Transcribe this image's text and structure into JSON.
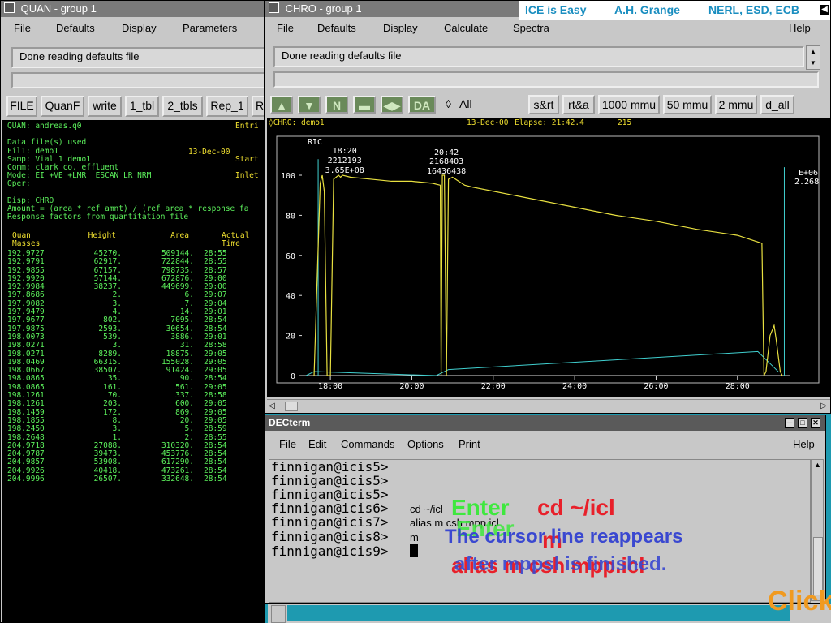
{
  "quan": {
    "title": "QUAN - group 1",
    "menu": [
      "File",
      "Defaults",
      "Display",
      "Parameters"
    ],
    "message": "Done reading defaults file",
    "toolbar": [
      "FILE",
      "QuanF",
      "write",
      "1_tbl",
      "2_tbls",
      "Rep_1",
      "R"
    ],
    "header_lines": [
      "QUAN: andreas.q0",
      "",
      "Data file(s) used",
      "Fil1: demo1",
      "Samp: Vial 1 demo1",
      "Comm: clark co. effluent",
      "Mode: EI +VE +LMR  ESCAN LR NRM",
      "Oper:",
      "",
      "Disp: CHRO",
      "Amount = (area * ref amnt) / (ref area * response fa",
      "Response factors from quantitation file"
    ],
    "header_right": [
      "Entri",
      "Start",
      "Inlet"
    ],
    "file_date": "13-Dec-00",
    "columns": [
      "Quan\nMasses",
      "Height",
      "Area",
      "Actual\nTime"
    ],
    "rows": [
      [
        "192.9727",
        "45270.",
        "509144.",
        "28:55"
      ],
      [
        "192.9791",
        "62917.",
        "722844.",
        "28:55"
      ],
      [
        "192.9855",
        "67157.",
        "798735.",
        "28:57"
      ],
      [
        "192.9920",
        "57144.",
        "672876.",
        "29:00"
      ],
      [
        "192.9984",
        "38237.",
        "449699.",
        "29:00"
      ],
      [
        "197.8686",
        "2.",
        "6.",
        "29:07"
      ],
      [
        "197.9082",
        "3.",
        "7.",
        "29:04"
      ],
      [
        "197.9479",
        "4.",
        "14.",
        "29:01"
      ],
      [
        "197.9677",
        "802.",
        "7095.",
        "28:54"
      ],
      [
        "197.9875",
        "2593.",
        "30654.",
        "28:54"
      ],
      [
        "198.0073",
        "539.",
        "3886.",
        "29:01"
      ],
      [
        "198.0271",
        "3.",
        "31.",
        "28:58"
      ],
      [
        "198.0271",
        "8289.",
        "18875.",
        "29:05"
      ],
      [
        "198.0469",
        "66315.",
        "155028.",
        "29:05"
      ],
      [
        "198.0667",
        "38507.",
        "91424.",
        "29:05"
      ],
      [
        "198.0865",
        "35.",
        "90.",
        "28:54"
      ],
      [
        "198.0865",
        "161.",
        "561.",
        "29:05"
      ],
      [
        "198.1261",
        "70.",
        "337.",
        "28:58"
      ],
      [
        "198.1261",
        "203.",
        "600.",
        "29:05"
      ],
      [
        "198.1459",
        "172.",
        "869.",
        "29:05"
      ],
      [
        "198.1855",
        "8.",
        "20.",
        "29:05"
      ],
      [
        "198.2450",
        "3.",
        "5.",
        "28:59"
      ],
      [
        "198.2648",
        "1.",
        "2.",
        "28:55"
      ],
      [
        "204.9718",
        "27088.",
        "310320.",
        "28:54"
      ],
      [
        "204.9787",
        "39473.",
        "453776.",
        "28:54"
      ],
      [
        "204.9857",
        "53908.",
        "617290.",
        "28:54"
      ],
      [
        "204.9926",
        "40418.",
        "473261.",
        "28:54"
      ],
      [
        "204.9996",
        "26507.",
        "332648.",
        "28:54"
      ]
    ]
  },
  "chro": {
    "title": "CHRO - group 1",
    "banner": [
      "ICE is Easy",
      "A.H. Grange",
      "NERL, ESD, ECB"
    ],
    "menu": [
      "File",
      "Defaults",
      "Display",
      "Calculate",
      "Spectra",
      "Help"
    ],
    "message": "Done reading defaults file",
    "all_label": "All",
    "da_label": "DA",
    "buttons": [
      "s&rt",
      "rt&a",
      "1000 mmu",
      "50 mmu",
      "2 mmu",
      "d_all"
    ],
    "plot_header": "CHRO: demo1",
    "plot_date": "13-Dec-00",
    "plot_elapse": "Elapse: 21:42.4",
    "plot_scan": "215",
    "ric_label": "RIC",
    "peak1": [
      "18:20",
      "2212193",
      "3.65E+08"
    ],
    "peak2": [
      "20:42",
      "2168403",
      "16436438"
    ],
    "scale_right": [
      "E+06",
      "2.268"
    ]
  },
  "chart_data": {
    "type": "line",
    "xlabel": "",
    "ylabel": "",
    "x_ticks": [
      "18:00",
      "20:00",
      "22:00",
      "24:00",
      "26:00",
      "28:00"
    ],
    "y_ticks": [
      "0",
      "20",
      "40",
      "60",
      "80",
      "100"
    ],
    "ylim": [
      0,
      100
    ],
    "series": [
      {
        "color": "#e8e040",
        "x": [
          17.6,
          17.75,
          17.8,
          17.85,
          17.92,
          18.0,
          18.08,
          18.2,
          18.25,
          18.3,
          18.5,
          19.0,
          19.5,
          20.0,
          20.5,
          20.7,
          20.72,
          20.75,
          20.8,
          20.85,
          20.9,
          21.0,
          21.3,
          21.5,
          22.0,
          23.0,
          24.0,
          25.0,
          26.0,
          27.0,
          28.0,
          28.6,
          28.65,
          28.7,
          28.8,
          28.9,
          28.95,
          29.05,
          29.1
        ],
        "y": [
          0,
          96,
          100,
          92,
          0,
          0,
          98,
          100,
          99,
          100,
          99,
          98,
          97,
          97,
          96,
          95,
          0,
          100,
          100,
          0,
          98,
          99,
          95,
          94,
          92,
          88,
          84,
          80,
          77,
          73,
          70,
          66,
          0,
          2,
          20,
          25,
          18,
          2,
          0
        ]
      }
    ]
  },
  "decterm": {
    "title": "DECterm",
    "menu": [
      "File",
      "Edit",
      "Commands",
      "Options",
      "Print",
      "Help"
    ],
    "prompts": [
      "finnigan@icis5>",
      "finnigan@icis5>",
      "finnigan@icis5>",
      "finnigan@icis6>",
      "finnigan@icis7>",
      "finnigan@icis8>",
      "finnigan@icis9>"
    ],
    "commands": [
      "",
      "",
      "",
      "cd ~/icl",
      "alias m csh mpp.icl",
      "m",
      ""
    ]
  },
  "overlay": {
    "enter_label": "Enter",
    "cmd1": "cd ~/icl",
    "enter_label2": "Enter",
    "cmd2": "m",
    "note1": "The cursor line reappears",
    "note2": "after mppsl is finished.",
    "alias": "alias m csh mpp.icl",
    "click": "Click"
  },
  "colors": {
    "desktop": "#1e9ab0",
    "term_green": "#5cf05c",
    "term_yellow": "#f0e030",
    "banner": "#1a8ec0"
  }
}
